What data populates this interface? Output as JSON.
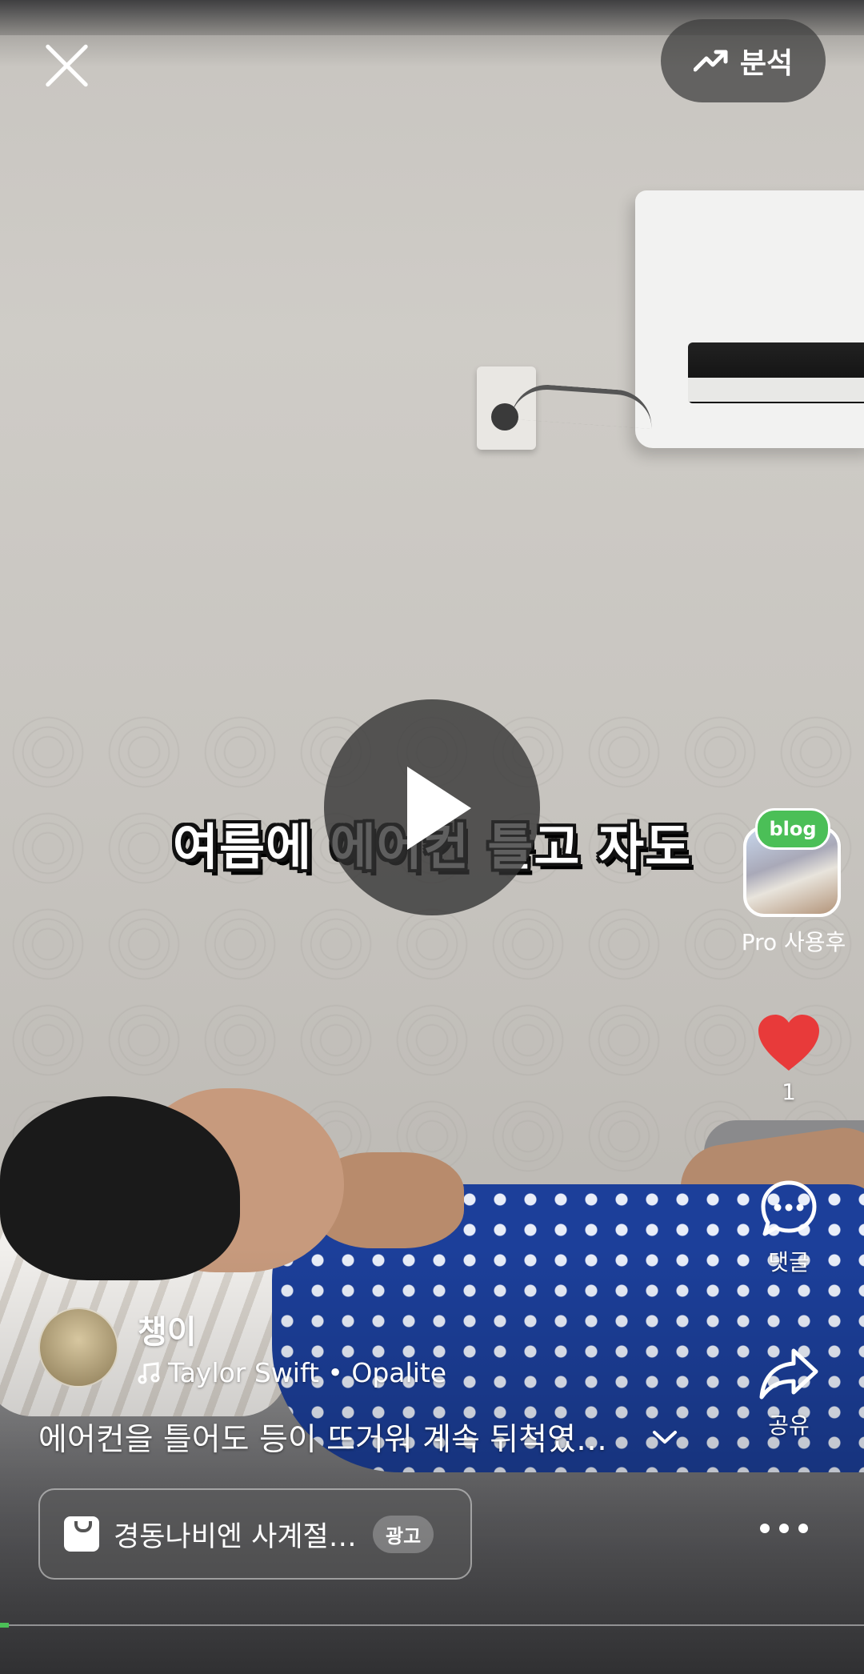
{
  "header": {
    "close_icon": "close-icon",
    "analysis_label": "분석",
    "analysis_icon": "trending-up-icon"
  },
  "video": {
    "caption": "여름에 에어컨 틀고 자도",
    "state": "paused",
    "progress": 0.01
  },
  "side": {
    "blog_badge": "blog",
    "blog_label": "Pro 사용후",
    "like_count": "1",
    "comment_label": "댓글",
    "share_label": "공유"
  },
  "author": {
    "name": "챙이",
    "music_icon": "music-note-icon",
    "music": "Taylor Swift • Opalite"
  },
  "description": "에어컨을 틀어도 등이 뜨거워 계속 뒤척였던...",
  "ad": {
    "title": "경동나비엔 사계절 ...",
    "badge": "광고"
  },
  "colors": {
    "like": "#e83a3a",
    "blog_green": "#4bbf57"
  }
}
